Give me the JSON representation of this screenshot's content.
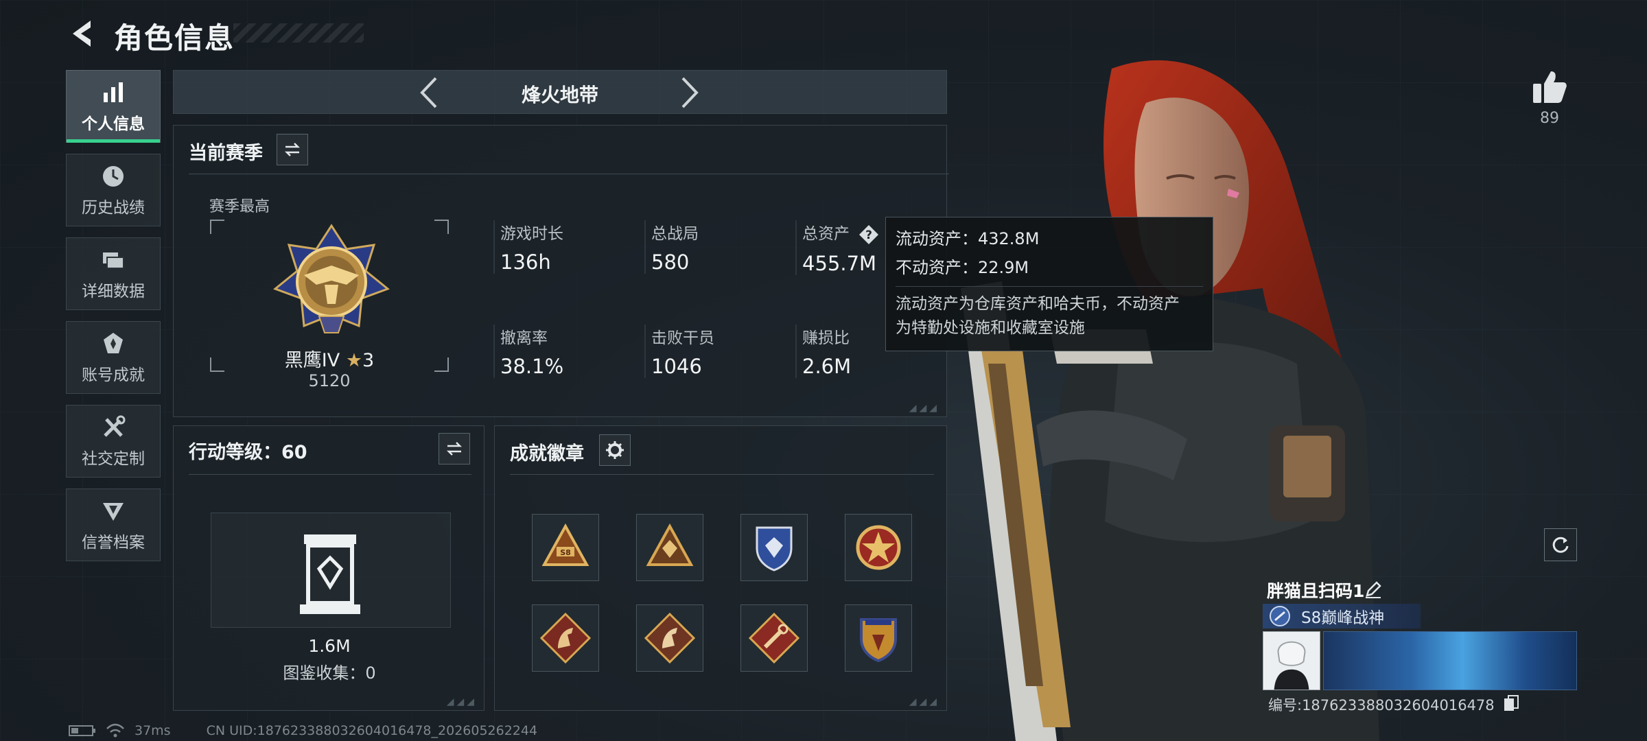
{
  "header": {
    "title": "角色信息"
  },
  "nav": {
    "items": [
      {
        "label": "个人信息",
        "icon": "bar-chart-icon",
        "active": true
      },
      {
        "label": "历史战绩",
        "icon": "clock-icon"
      },
      {
        "label": "详细数据",
        "icon": "folders-icon"
      },
      {
        "label": "账号成就",
        "icon": "achievement-icon"
      },
      {
        "label": "社交定制",
        "icon": "tools-icon"
      },
      {
        "label": "信誉档案",
        "icon": "credit-shield-icon"
      }
    ]
  },
  "mode": {
    "title": "烽火地带"
  },
  "season": {
    "title": "当前赛季",
    "best_label": "赛季最高",
    "rank_name": "黑鹰IV",
    "rank_stars": "3",
    "rank_points": "5120",
    "stats": [
      {
        "label": "游戏时长",
        "value": "136h"
      },
      {
        "label": "总战局",
        "value": "580"
      },
      {
        "label": "总资产",
        "value": "455.7M"
      },
      {
        "label": "撤离率",
        "value": "38.1%"
      },
      {
        "label": "击败干员",
        "value": "1046"
      },
      {
        "label": "赚损比",
        "value": "2.6M"
      }
    ]
  },
  "tooltip": {
    "liquid": "流动资产：432.8M",
    "fixed": "不动资产：22.9M",
    "desc_line1": "流动资产为仓库资产和哈夫币，不动资产",
    "desc_line2": "为特勤处设施和收藏室设施"
  },
  "action_level": {
    "title": "行动等级：60",
    "value": "1.6M",
    "collection": "图鉴收集：0"
  },
  "badges": {
    "title": "成就徽章",
    "items": [
      {
        "icon": "triangle-s8-badge-icon"
      },
      {
        "icon": "triangle-gem-badge-icon"
      },
      {
        "icon": "blue-shield-badge-icon"
      },
      {
        "icon": "red-star-badge-icon"
      },
      {
        "icon": "horse-diamond-badge-icon"
      },
      {
        "icon": "horse-diamond-badge-icon"
      },
      {
        "icon": "wrench-diamond-badge-icon"
      },
      {
        "icon": "gold-shield-badge-icon"
      }
    ]
  },
  "player": {
    "likes": "89",
    "name": "胖猫且扫码1",
    "title": "S8巅峰战神",
    "id_line": "编号:18762338803260401647​8"
  },
  "footer": {
    "ping": "37ms",
    "uid": "CN UID:1876233880326040164​78_202605262244"
  },
  "colors": {
    "accent": "#38d08f",
    "panel_border": "#3a444b"
  }
}
